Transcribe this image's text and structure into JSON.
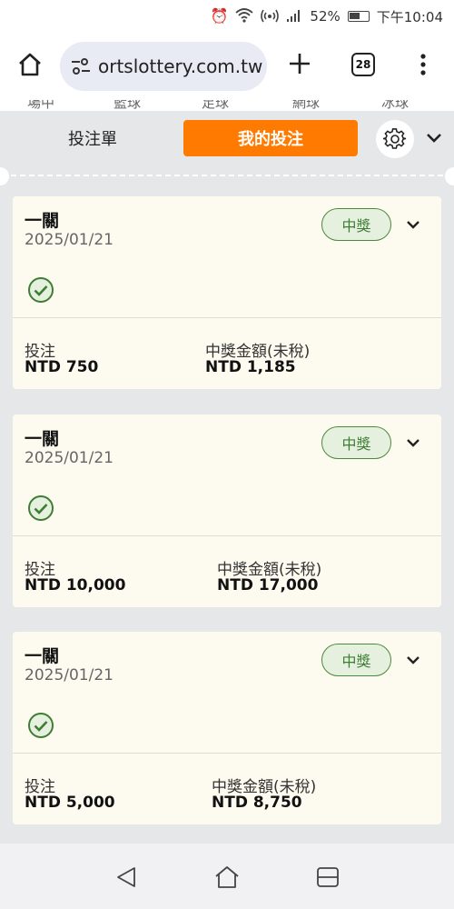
{
  "status_bar": {
    "battery": "52%",
    "time": "下午10:04"
  },
  "browser": {
    "url": "ortslottery.com.tw",
    "tab_count": "28"
  },
  "site_nav_cut": [
    "場中",
    "籃球",
    "足球",
    "網球",
    "冰球"
  ],
  "tabs": {
    "bet_slip": "投注單",
    "my_bets": "我的投注"
  },
  "bets": [
    {
      "title": "一關",
      "date": "2025/01/21",
      "status": "中獎",
      "stake_label": "投注",
      "stake_value": "NTD 750",
      "payout_label": "中獎金額(未稅)",
      "payout_value": "NTD 1,185"
    },
    {
      "title": "一關",
      "date": "2025/01/21",
      "status": "中獎",
      "stake_label": "投注",
      "stake_value": "NTD 10,000",
      "payout_label": "中獎金額(未稅)",
      "payout_value": "NTD 17,000"
    },
    {
      "title": "一關",
      "date": "2025/01/21",
      "status": "中獎",
      "stake_label": "投注",
      "stake_value": "NTD 5,000",
      "payout_label": "中獎金額(未稅)",
      "payout_value": "NTD 8,750"
    }
  ],
  "colors": {
    "accent": "#ff7a00",
    "win_green": "#3f7d35",
    "card_bg": "#fdfaf0",
    "panel_bg": "#e6e7e9"
  },
  "icons": [
    "alarm-icon",
    "wifi-icon",
    "hotspot-icon",
    "signal-icon",
    "battery-icon",
    "home-icon",
    "tune-icon",
    "plus-icon",
    "tabs-icon",
    "more-vert-icon",
    "gear-icon",
    "chevron-down-icon",
    "check-circle-icon",
    "nav-back-icon",
    "nav-home-icon",
    "nav-recents-icon"
  ]
}
